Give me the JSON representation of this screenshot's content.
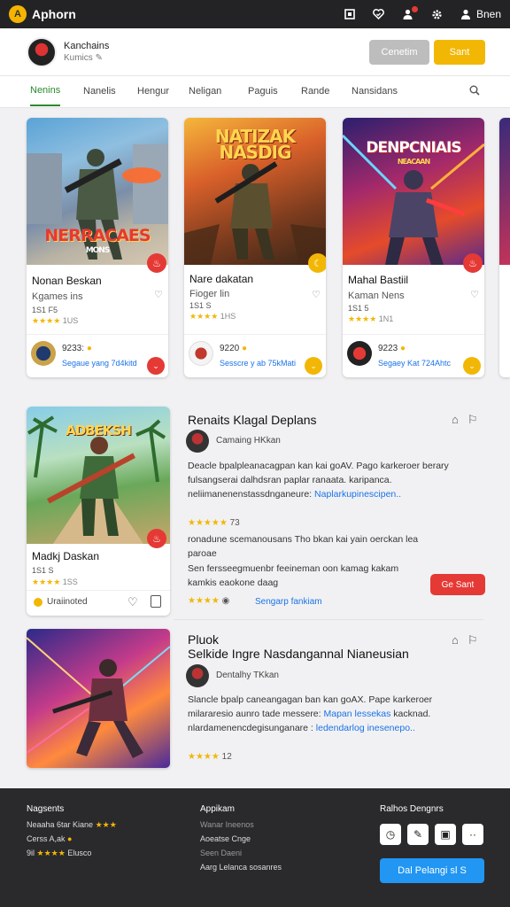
{
  "header": {
    "logo_glyph": "A",
    "app_title": "Aphorn",
    "signin_label": "Bnen"
  },
  "profile": {
    "name": "Kanchains",
    "sub": "Kumics",
    "button_secondary": "Cenetim",
    "button_primary": "Sant"
  },
  "tabs": [
    "Nenins",
    "Nanelis",
    "Hengur",
    "Neligan",
    "Paguis",
    "Rande",
    "Nansidans"
  ],
  "cards": [
    {
      "image_title": "NERRACAES",
      "image_sub": "MONS",
      "title": "Nonan Beskan",
      "subtitle": "Kgames ins",
      "meta": "1S1 F5",
      "stars": "★★★★",
      "star_count": "1US",
      "price": "9233:",
      "link": "Segaue yang 7d4kitd",
      "accent": "#e53935"
    },
    {
      "image_title": "NATIZAK NASDIG",
      "image_sub": "",
      "title": "Nare dakatan",
      "subtitle": "Fioger lin",
      "meta": "1S1 S",
      "stars": "★★★★",
      "star_count": "1HS",
      "price": "9220",
      "link": "Sesscre y ab 75kMati",
      "accent": "#e5a800"
    },
    {
      "image_title": "DENPCNIAIS",
      "image_sub": "NEACAAN",
      "title": "Mahal Bastiil",
      "subtitle": "Kaman Nens",
      "meta": "1S1 5",
      "stars": "★★★★",
      "star_count": "1N1",
      "price": "9223",
      "link": "Segaey Kat 724Ahtc",
      "accent": "#e5a800"
    }
  ],
  "featured1": {
    "image_title": "ADBEKSH",
    "name": "Madkj Daskan",
    "meta": "1S1 S",
    "stars": "★★★★",
    "star_count": "1SS",
    "tag": "Uraiinoted",
    "section_title": "Renaits Klagal Deplans",
    "author": "Camaing HKkan",
    "desc_1": "Deacle bpalpleanacagpan kan kai goAV. Pago karkeroer berary fulsangserai dalhdsran paplar ranaata. karipanca.",
    "desc_2": "neliimanenenstassdnganeure:",
    "desc_link": "Naplarkupinescipen..",
    "rating_stars": "★★★★★",
    "rating_count": "73",
    "desc_3": "ronadune scemanousans Tho bkan kai yain oerckan lea paroae",
    "desc_4": "Sen fersseegmuenbr feeineman oon kamag kakam kamkis eaokone daag",
    "red_button": "Ge Sant",
    "footer_stars": "★★★★",
    "footer_link": "Sengarp fankiam"
  },
  "featured2": {
    "section_title_1": "Pluok",
    "section_title_2": "Selkide Ingre Nasdangannal Nianeusian",
    "author": "Dentalhy TKkan",
    "desc_1": "Slancle bpalp caneangagan ban kan goAX. Pape karkeroer",
    "desc_2": "milararesio aunro tade messere:",
    "desc_link_1": "Mapan lessekas",
    "desc_2b": "kacknad.",
    "desc_3": "nlardamenencdegisunganare :",
    "desc_link_2": "ledendarlog inesenepo..",
    "rating_stars": "★★★★",
    "rating_count": "12"
  },
  "footer": {
    "col1_title": "Nagsents",
    "col1_item1": "Neaaha 6tar Kiane",
    "col1_item1_stars": "★★★",
    "col1_item2": "Cerss A,ak",
    "col1_item3_pre": "9il",
    "col1_item3_stars": "★★★★",
    "col1_item3_post": "Elusco",
    "col2_title": "Appikam",
    "col2_item1": "Wanar Ineenos",
    "col2_item2": "Aoeatse Cnge",
    "col2_item3": "Seen Daeni",
    "col2_item4": "Aarg Lelanca sosanres",
    "col3_title": "Ralhos Dengnrs",
    "cta": "Dal Pelangi sl S"
  },
  "colors": {
    "topbar": "#232326",
    "primary_yellow": "#f2b705",
    "tab_active": "#2a8a2a",
    "link_blue": "#1a73e8",
    "danger_red": "#e53935",
    "footer_bg": "#2a2a2d",
    "cta_blue": "#2196f3"
  }
}
